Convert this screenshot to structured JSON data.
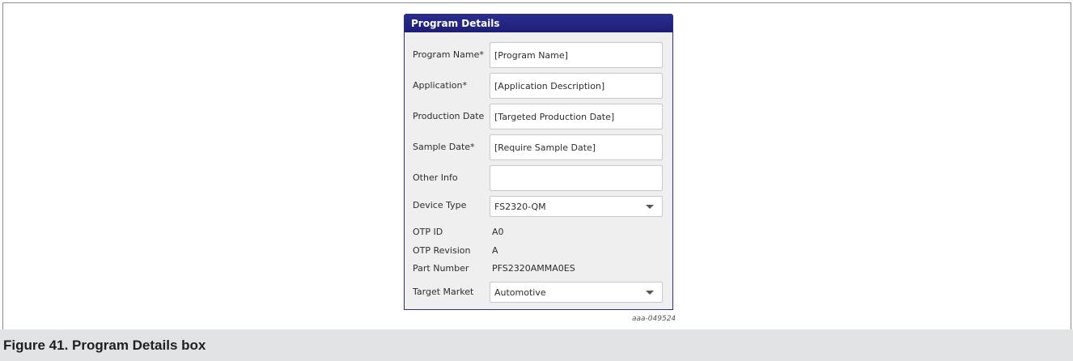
{
  "panel": {
    "title": "Program Details",
    "fields": [
      {
        "label": "Program Name*",
        "value": "[Program Name]"
      },
      {
        "label": "Application*",
        "value": "[Application Description]"
      },
      {
        "label": "Production Date",
        "value": "[Targeted Production Date]"
      },
      {
        "label": "Sample Date*",
        "value": "[Require Sample Date]"
      },
      {
        "label": "Other Info",
        "value": ""
      }
    ],
    "device_type": {
      "label": "Device Type",
      "selected": "FS2320-QM"
    },
    "otp_id": {
      "label": "OTP ID",
      "value": "A0"
    },
    "otp_revision": {
      "label": "OTP Revision",
      "value": "A"
    },
    "part_number": {
      "label": "Part Number",
      "value": "PFS2320AMMA0ES"
    },
    "target_market": {
      "label": "Target Market",
      "selected": "Automotive"
    }
  },
  "figure_id": "aaa-049524",
  "caption": "Figure 41.  Program Details box",
  "icons": {
    "dropdown": "chevron-down-icon"
  },
  "colors": {
    "header": "#2b2d8e",
    "panel_bg": "#efefef",
    "caption_bg": "#e2e3e5"
  }
}
